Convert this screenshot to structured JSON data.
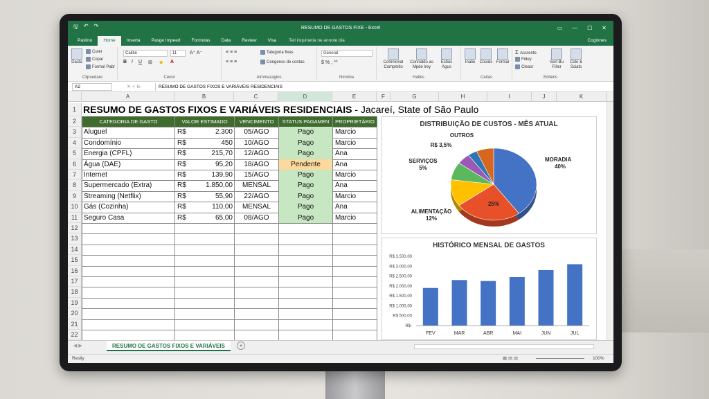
{
  "window": {
    "title": "RESUMO DE GASTOS FIXE - Excel",
    "controls": [
      "▭",
      "—",
      "☐",
      "✕"
    ]
  },
  "qat": {
    "save": "🖫",
    "undo": "↶",
    "redo": "↷"
  },
  "tabs": [
    "Paslino",
    "Home",
    "Inserta",
    "Pasge Impeed",
    "Formulas",
    "Data",
    "Review",
    "Visa"
  ],
  "active_tab": "Home",
  "tell_me": "Tell inquinetia ne annote dia",
  "user": "Coginnes",
  "ribbon": {
    "clipboard": {
      "paste": "Dasta",
      "cut": "Cuter",
      "copy": "Copar",
      "format_painter": "Formol Pabr",
      "label": "Clipuedare"
    },
    "font": {
      "name": "Calibn",
      "size": "11",
      "label": "Ceoot"
    },
    "alignment": {
      "wrap": "Tategoria fixas",
      "merge": "Congenss de contas",
      "label": "Almmazagios"
    },
    "number": {
      "format": "General",
      "label": "Nmmba"
    },
    "styles": {
      "conditional": "Comnional Compmito",
      "format_table": "Connaldo as Mpde lrey",
      "cell_styles": "Estios Agus",
      "label": "Halles"
    },
    "cells": {
      "insert": "Inalie",
      "delete": "Covats",
      "format": "Formal",
      "label": "Ceitas"
    },
    "editing": {
      "autosum": "Accrente",
      "fill": "Fidey",
      "clear": "Cleasr",
      "sort": "Sert Bu Filter",
      "find": "Colo & Sciats",
      "label": "Editeris"
    }
  },
  "formula_bar": {
    "name_box": "A2",
    "fx": "fx",
    "content": "RESUMO DE GASTOS FIXOS E VARIÁVEIS RESIDENCIAIS"
  },
  "columns": [
    "A",
    "B",
    "C",
    "D",
    "E",
    "F",
    "G",
    "H",
    "I",
    "J",
    "K"
  ],
  "rows": [
    "1",
    "2",
    "3",
    "4",
    "5",
    "6",
    "7",
    "8",
    "9",
    "10",
    "11",
    "12",
    "13",
    "14",
    "15",
    "16",
    "17",
    "18",
    "19",
    "20",
    "21",
    "22"
  ],
  "sheet": {
    "title": "RESUMO DE GASTOS FIXOS E VARIÁVEIS RESIDENCIAIS",
    "location": " - Jacareí, State of São Paulo",
    "headers": [
      "CATEGORIA DE GASTO",
      "VALOR ESTIMADO",
      "VENCIMENTO",
      "STATUS PAGAMEN",
      "PROPRIETÁRIO"
    ],
    "rows": [
      {
        "category": "Aluguel",
        "currency": "R$",
        "value": "2.300",
        "due": "05/AGO",
        "status": "Pago",
        "owner": "Marcio"
      },
      {
        "category": "Condomínio",
        "currency": "R$",
        "value": "450",
        "due": "10/AGO",
        "status": "Pago",
        "owner": "Marcio"
      },
      {
        "category": "Energia (CPFL)",
        "currency": "R$",
        "value": "215,70",
        "due": "12/AGO",
        "status": "Pago",
        "owner": "Ana"
      },
      {
        "category": "Água (DAE)",
        "currency": "R$",
        "value": "95,20",
        "due": "18/AGO",
        "status": "Pendente",
        "owner": "Ana"
      },
      {
        "category": "Internet",
        "currency": "R$",
        "value": "139,90",
        "due": "15/AGO",
        "status": "Pago",
        "owner": "Marcio"
      },
      {
        "category": "Supermercado (Extra)",
        "currency": "R$",
        "value": "1.850,00",
        "due": "MENSAL",
        "status": "Pago",
        "owner": "Ana"
      },
      {
        "category": "Streaming (Netflix)",
        "currency": "R$",
        "value": "55,90",
        "due": "22/AGO",
        "status": "Pago",
        "owner": "Marcio"
      },
      {
        "category": "Gás (Cozinha)",
        "currency": "R$",
        "value": "110,00",
        "due": "MENSAL",
        "status": "Pago",
        "owner": "Ana"
      },
      {
        "category": "Seguro Casa",
        "currency": "R$",
        "value": "65,00",
        "due": "08/AGO",
        "status": "Pago",
        "owner": "Marcio"
      }
    ]
  },
  "sheet_tab": "RESUMO DE GASTOS FIXOS E VARIÁVEIS",
  "status_bar": {
    "ready": "Resily",
    "zoom": "100%"
  },
  "colors": {
    "excel_green": "#217346",
    "header_green": "#3f6b2f",
    "paid": "#c7e6c2",
    "pending": "#fcd99c",
    "bar": "#4472c4"
  },
  "chart_data": [
    {
      "type": "pie",
      "title": "DISTRIBUIÇÃO DE CUSTOS - MÊS ATUAL",
      "slices": [
        {
          "label": "MORADIA",
          "value": 40,
          "display": "MORADIA\n40%",
          "color": "#4472c4"
        },
        {
          "label": "",
          "value": 25,
          "display": "25%",
          "color": "#e8502a"
        },
        {
          "label": "ALIMENTAÇÃO",
          "value": 12,
          "display": "ALIMENTAÇÃO\n12%",
          "color": "#ffc000"
        },
        {
          "label": "",
          "value": 8,
          "display": "",
          "color": "#5cb85c"
        },
        {
          "label": "SERVIÇOS",
          "value": 5,
          "display": "SERVIÇOS\n5%",
          "color": "#9b59b6"
        },
        {
          "label": "R$",
          "value": 3.5,
          "display": "R$ 3,5%",
          "color": "#2e75b6"
        },
        {
          "label": "OUTROS",
          "value": 6.5,
          "display": "OUTROS",
          "color": "#d9661f"
        }
      ]
    },
    {
      "type": "bar",
      "title": "HISTÓRICO MENSAL DE GASTOS",
      "categories": [
        "FEV",
        "MAR",
        "ABR",
        "MAI",
        "JUN",
        "JUL"
      ],
      "values": [
        1900,
        2300,
        2250,
        2450,
        2800,
        3100
      ],
      "yticks": [
        "R$ 3.500,00",
        "R$ 3.000,00",
        "R$ 2.500,00",
        "R$ 2.000,00",
        "R$ 1.500,00",
        "R$ 1.000,00",
        "R$ 500,00",
        "R$-"
      ],
      "ylim": [
        0,
        3500
      ]
    }
  ]
}
